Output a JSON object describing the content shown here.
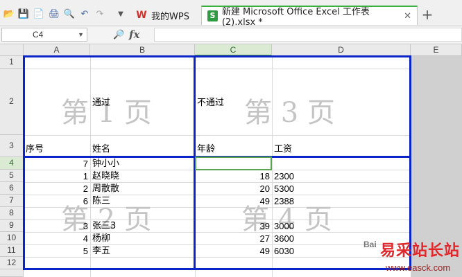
{
  "app": {
    "tabs": [
      {
        "label": "我的WPS"
      },
      {
        "label": "新建 Microsoft Office Excel 工作表 (2).xlsx *"
      }
    ]
  },
  "formula_bar": {
    "name_box": "C4",
    "fx_label": "fx",
    "value": ""
  },
  "sheet": {
    "columns": [
      "A",
      "B",
      "C",
      "D",
      "E"
    ],
    "rows": [
      "1",
      "2",
      "3",
      "4",
      "5",
      "6",
      "7",
      "8",
      "9",
      "10",
      "11",
      "12"
    ],
    "header_row2": {
      "b": "通过",
      "c": "不通过"
    },
    "header_row3": {
      "a": "序号",
      "b": "姓名",
      "c": "年龄",
      "d": "工资"
    },
    "data": [
      {
        "row": "4",
        "a": "7",
        "b": "钟小小",
        "c": "",
        "d": ""
      },
      {
        "row": "5",
        "a": "1",
        "b": "赵晓晓",
        "c": "18",
        "d": "2300"
      },
      {
        "row": "6",
        "a": "2",
        "b": "周散散",
        "c": "20",
        "d": "5300"
      },
      {
        "row": "7",
        "a": "6",
        "b": "陈三",
        "c": "49",
        "d": "2388"
      },
      {
        "row": "8",
        "a": "",
        "b": "",
        "c": "",
        "d": ""
      },
      {
        "row": "9",
        "a": "3",
        "b": "张三3",
        "c": "39",
        "d": "3000"
      },
      {
        "row": "10",
        "a": "4",
        "b": "杨柳",
        "c": "27",
        "d": "3600"
      },
      {
        "row": "11",
        "a": "5",
        "b": "李五",
        "c": "49",
        "d": "6030"
      }
    ],
    "page_watermarks": [
      "第 1 页",
      "第 3 页",
      "第 2 页",
      "第 4 页"
    ]
  },
  "site_logo": {
    "title": "易采站长站",
    "url": "www.easck.com",
    "badge": "Bai"
  },
  "colors": {
    "page_break": "#0b24c8",
    "active_cell": "#5aa34f",
    "tab_accent": "#3cb043"
  }
}
